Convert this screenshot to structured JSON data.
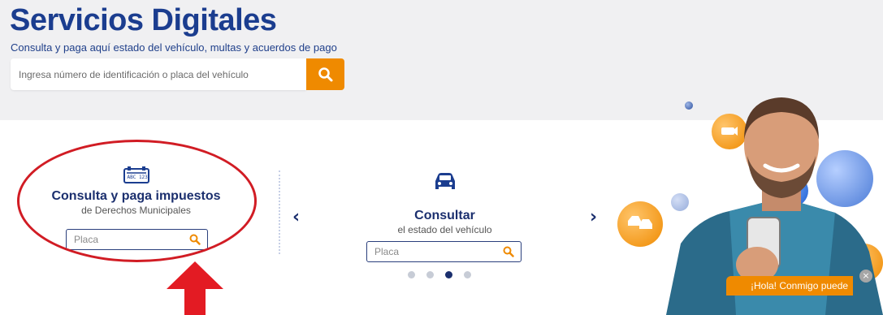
{
  "header": {
    "title": "Servicios Digitales",
    "subtitle": "Consulta y paga aquí estado del vehículo, multas y acuerdos de pago",
    "search_placeholder": "Ingresa número de identificación o placa del vehículo",
    "search_button_icon": "search-icon"
  },
  "panels": [
    {
      "icon": "license-plate-icon",
      "plate_icon_text": "ABC 123",
      "title": "Consulta y paga impuestos",
      "subtitle": "de Derechos Municipales",
      "input_placeholder": "Placa"
    },
    {
      "icon": "car-icon",
      "title": "Consultar",
      "subtitle": "el estado del vehículo",
      "input_placeholder": "Placa"
    }
  ],
  "carousel": {
    "prev_arrow": "‹",
    "next_arrow": "›",
    "dots": 4,
    "active_dot": 3
  },
  "chat": {
    "label": "¡Hola! Conmigo puede",
    "close_symbol": "×"
  },
  "colors": {
    "brand_blue": "#1b3d8f",
    "accent_orange": "#ef8a00",
    "annotation_red": "#d11c24"
  }
}
